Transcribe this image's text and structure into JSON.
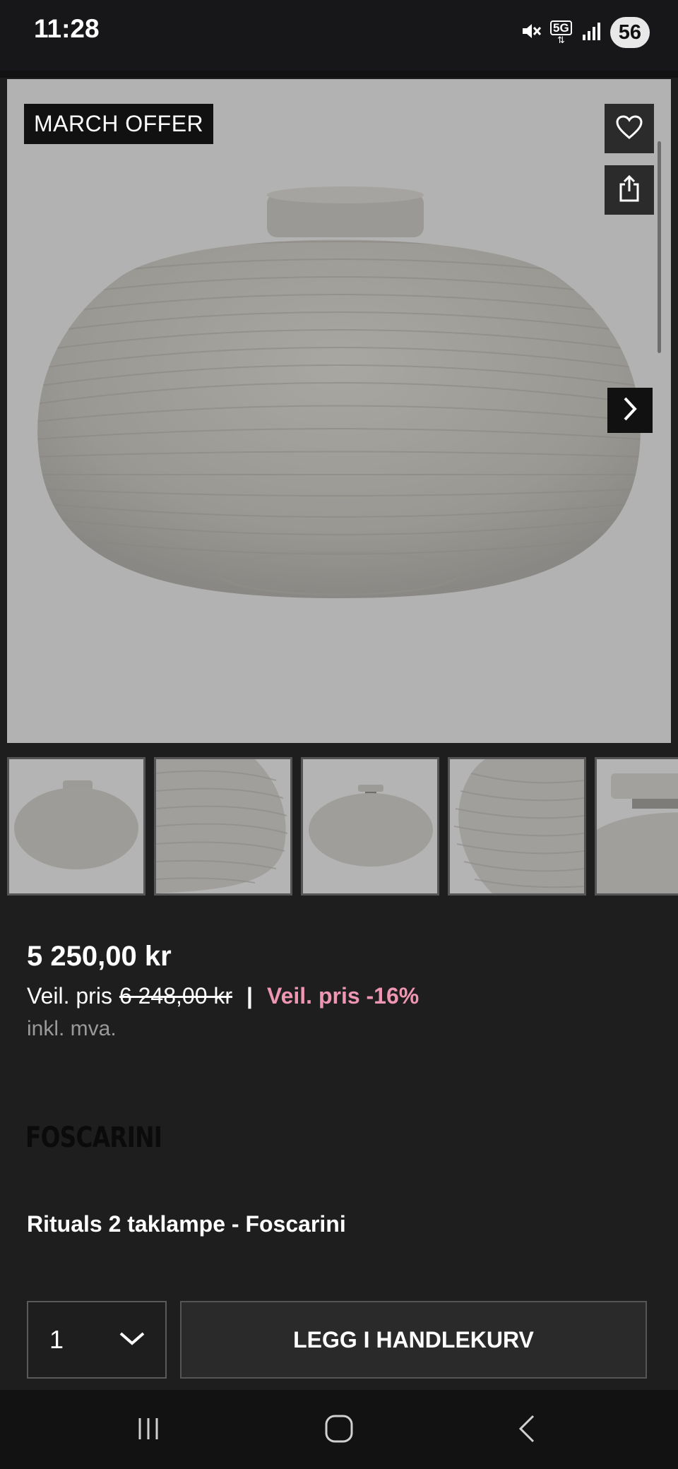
{
  "status_bar": {
    "time": "11:28",
    "network": "5G",
    "battery": "56",
    "icons": [
      "mute-icon",
      "network-5g-icon",
      "signal-icon",
      "battery-icon"
    ]
  },
  "gallery": {
    "badge": "MARCH OFFER",
    "icons": [
      "heart-icon",
      "share-icon",
      "chevron-right-icon"
    ],
    "thumbnail_count": 5
  },
  "pricing": {
    "price": "5 250,00 kr",
    "reference_label": "Veil. pris",
    "old_price": "6 248,00 kr",
    "separator": "|",
    "discount_label": "Veil. pris -16%",
    "vat_note": "inkl. mva."
  },
  "brand": {
    "logo_text": "FOSCARINI"
  },
  "product": {
    "title": "Rituals 2 taklampe - Foscarini"
  },
  "cart": {
    "quantity": "1",
    "add_button": "LEGG I HANDLEKURV"
  },
  "nav": {
    "icons": [
      "recent-apps-icon",
      "home-icon",
      "back-icon"
    ]
  },
  "colors": {
    "background": "#1e1e1e",
    "discount": "#ee96b2",
    "image_background": "#b2b2b2"
  }
}
